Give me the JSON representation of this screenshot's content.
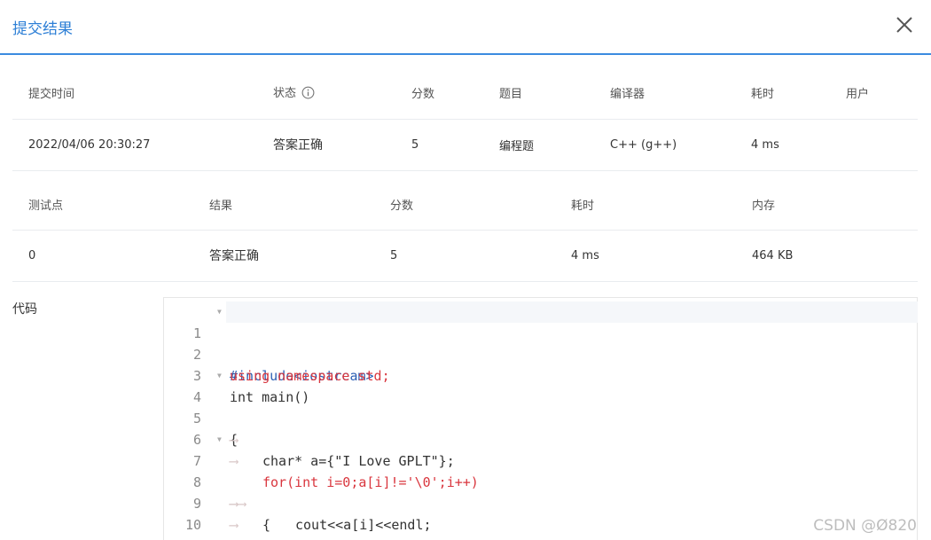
{
  "dialog": {
    "title": "提交结果"
  },
  "summary": {
    "headers": [
      "提交时间",
      "状态",
      "分数",
      "题目",
      "编译器",
      "耗时",
      "用户"
    ],
    "row": [
      "2022/04/06 20:30:27",
      "答案正确",
      "5",
      "编程题",
      "C++ (g++)",
      "4 ms",
      ""
    ]
  },
  "cases": {
    "headers": [
      "测试点",
      "结果",
      "分数",
      "耗时",
      "内存"
    ],
    "row": [
      "0",
      "答案正确",
      "5",
      "4 ms",
      "464 KB"
    ]
  },
  "code": {
    "label": "代码",
    "line_numbers": [
      "1",
      "2",
      "3",
      "4",
      "5",
      "6",
      "7",
      "8",
      "9",
      "10"
    ],
    "lines": [
      "#include<iostream>",
      "using namespace std;",
      "int main()",
      "{",
      "char* a={\"I Love GPLT\"};",
      "for(int i=0;a[i]!='\\0';i++)",
      "{",
      "cout<<a[i]<<endl;",
      "}",
      "}"
    ]
  },
  "watermark": "CSDN @Ø820",
  "colors": {
    "accent": "#2d7fd6",
    "success_text": "#e4393c"
  },
  "icons": {
    "close": "close-icon",
    "info": "info-icon",
    "fold": "fold-arrow-icon"
  }
}
